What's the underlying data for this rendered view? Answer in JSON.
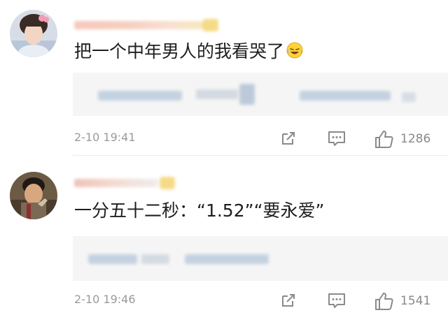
{
  "comments": [
    {
      "text": "把一个中年男人的我看哭了",
      "timestamp": "2-10 19:41",
      "likes": "1286",
      "text_emoji": "laughing-crying-emoji"
    },
    {
      "text": "一分五十二秒：“1.52”“要永爱”",
      "timestamp": "2-10 19:46",
      "likes": "1541"
    }
  ],
  "icons": {
    "share": "share-icon",
    "reply": "comment-icon",
    "like": "thumbs-up-icon"
  },
  "colors": {
    "text": "#1e1e1e",
    "meta": "#9a9a9a",
    "reply_bg": "#f5f5f5",
    "icon": "#8a8a8a"
  }
}
